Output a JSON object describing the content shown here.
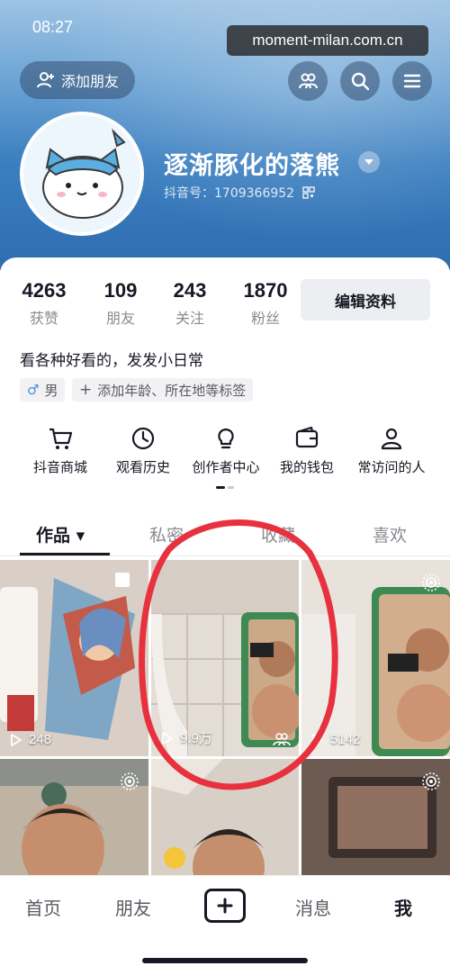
{
  "status_bar": {
    "time": "08:27"
  },
  "watermark": {
    "text": "moment-milan.com.cn"
  },
  "header": {
    "add_friend_label": "添加朋友",
    "icons": [
      "friends-icon",
      "search-icon",
      "menu-icon"
    ]
  },
  "profile": {
    "nickname": "逐渐豚化的落熊",
    "douyin_id": "抖音号：1709366952",
    "bio": "看各种好看的，发发小日常",
    "tags": [
      "男",
      "添加年龄、所在地等标签"
    ]
  },
  "stats": [
    {
      "value": "4263",
      "label": "获赞"
    },
    {
      "value": "109",
      "label": "朋友"
    },
    {
      "value": "243",
      "label": "关注"
    },
    {
      "value": "1870",
      "label": "粉丝"
    }
  ],
  "edit_profile_label": "编辑资料",
  "shortcuts": [
    {
      "label": "抖音商城",
      "icon": "cart-icon"
    },
    {
      "label": "观看历史",
      "icon": "clock-icon"
    },
    {
      "label": "创作者中心",
      "icon": "lightbulb-icon"
    },
    {
      "label": "我的钱包",
      "icon": "wallet-icon"
    },
    {
      "label": "常访问的人",
      "icon": "person-icon"
    }
  ],
  "tabs": [
    {
      "label": "作品 ▾",
      "active": true
    },
    {
      "label": "私密",
      "active": false
    },
    {
      "label": "收藏",
      "active": false
    },
    {
      "label": "喜欢",
      "active": false
    }
  ],
  "videos": [
    {
      "plays": "248"
    },
    {
      "plays": "9.9万"
    },
    {
      "plays": "5142"
    }
  ],
  "bottom_nav": [
    {
      "label": "首页"
    },
    {
      "label": "朋友"
    },
    {
      "label": "消息"
    },
    {
      "label": "我"
    }
  ],
  "colors": {
    "header_top": "#9ec3e4",
    "header_bottom": "#2e6db0",
    "annotation_red": "#e8313f"
  }
}
